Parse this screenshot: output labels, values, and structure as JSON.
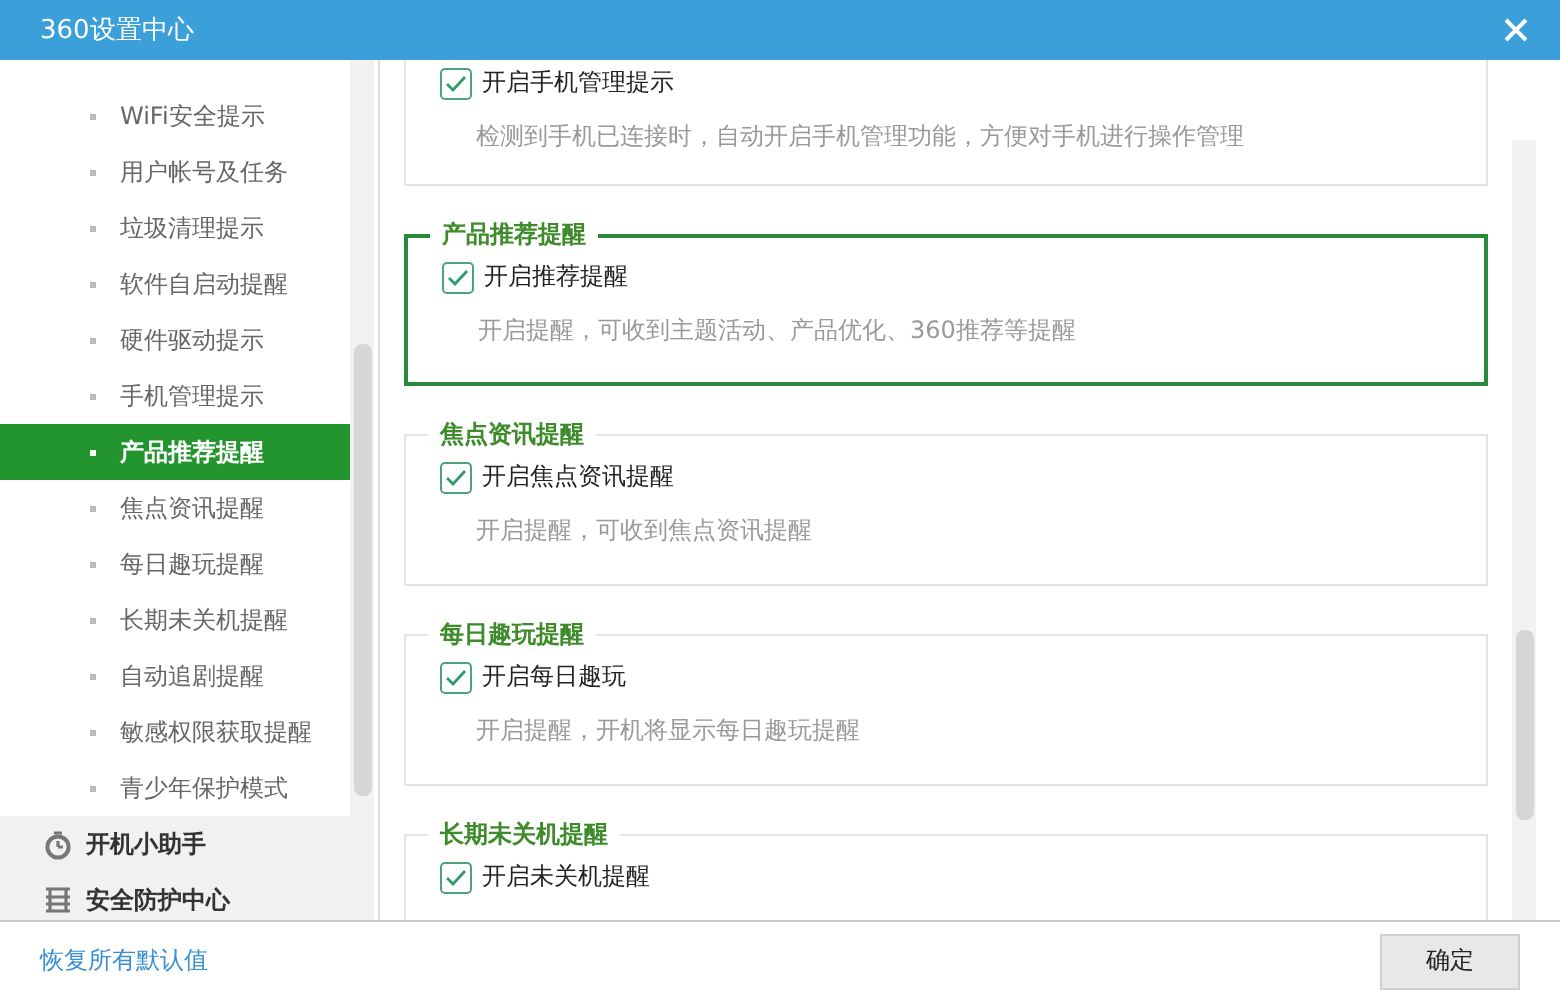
{
  "window": {
    "title": "360设置中心"
  },
  "sidebar": {
    "items": [
      {
        "label": "WiFi安全提示",
        "selected": false
      },
      {
        "label": "用户帐号及任务",
        "selected": false
      },
      {
        "label": "垃圾清理提示",
        "selected": false
      },
      {
        "label": "软件自启动提醒",
        "selected": false
      },
      {
        "label": "硬件驱动提示",
        "selected": false
      },
      {
        "label": "手机管理提示",
        "selected": false
      },
      {
        "label": "产品推荐提醒",
        "selected": true
      },
      {
        "label": "焦点资讯提醒",
        "selected": false
      },
      {
        "label": "每日趣玩提醒",
        "selected": false
      },
      {
        "label": "长期未关机提醒",
        "selected": false
      },
      {
        "label": "自动追剧提醒",
        "selected": false
      },
      {
        "label": "敏感权限获取提醒",
        "selected": false
      },
      {
        "label": "青少年保护模式",
        "selected": false
      }
    ],
    "groups": [
      {
        "label": "开机小助手",
        "kind": "timer"
      },
      {
        "label": "安全防护中心",
        "kind": "shield"
      }
    ]
  },
  "sections": [
    {
      "selected": false,
      "option": {
        "label": "开启手机管理提示",
        "checked": true
      },
      "description": "检测到手机已连接时，自动开启手机管理功能，方便对手机进行操作管理"
    },
    {
      "title": "产品推荐提醒",
      "selected": true,
      "option": {
        "label": "开启推荐提醒",
        "checked": true
      },
      "description": "开启提醒，可收到主题活动、产品优化、360推荐等提醒"
    },
    {
      "title": "焦点资讯提醒",
      "selected": false,
      "option": {
        "label": "开启焦点资讯提醒",
        "checked": true
      },
      "description": "开启提醒，可收到焦点资讯提醒"
    },
    {
      "title": "每日趣玩提醒",
      "selected": false,
      "option": {
        "label": "开启每日趣玩",
        "checked": true
      },
      "description": "开启提醒，开机将显示每日趣玩提醒"
    },
    {
      "title": "长期未关机提醒",
      "selected": false,
      "option": {
        "label": "开启未关机提醒",
        "checked": true
      }
    }
  ],
  "footer": {
    "restore_link": "恢复所有默认值",
    "ok_button": "确定"
  }
}
